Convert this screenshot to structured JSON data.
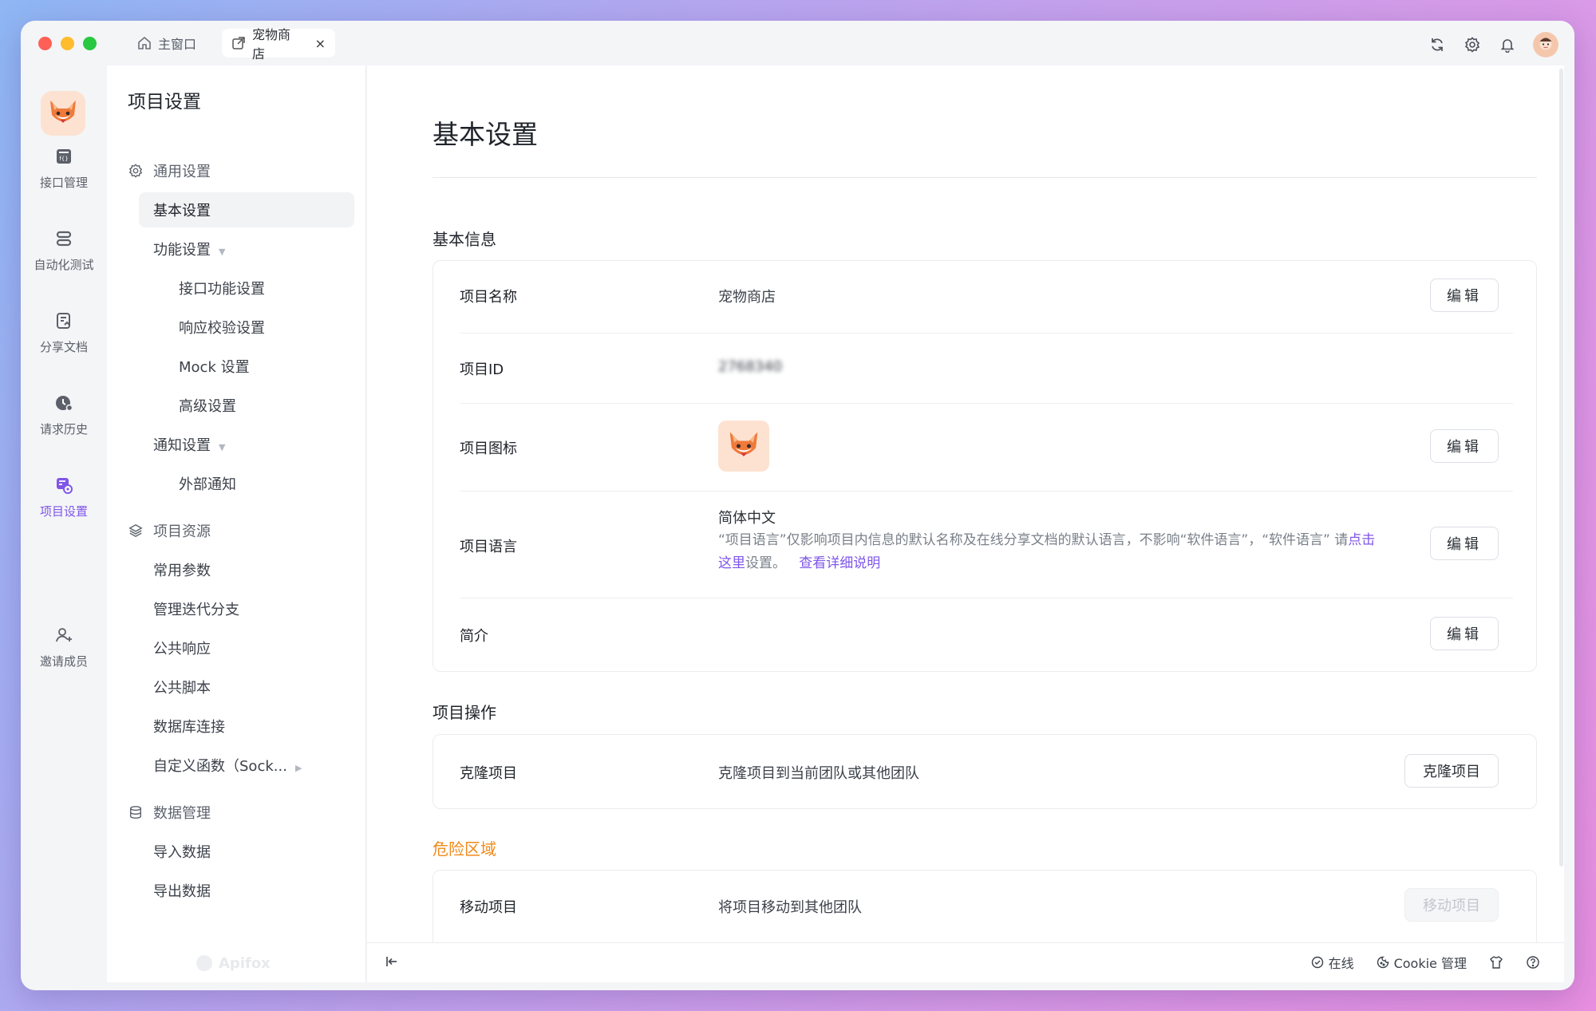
{
  "tabs": [
    {
      "label": "主窗口",
      "icon": "home-icon"
    },
    {
      "label": "宠物商店",
      "icon": "external-link-icon",
      "close": "×"
    }
  ],
  "rail": [
    {
      "label": "接口管理",
      "icon": "api-management-icon"
    },
    {
      "label": "自动化测试",
      "icon": "automation-test-icon"
    },
    {
      "label": "分享文档",
      "icon": "share-doc-icon"
    },
    {
      "label": "请求历史",
      "icon": "history-icon"
    },
    {
      "label": "项目设置",
      "icon": "project-settings-icon",
      "active": true
    },
    {
      "label": "邀请成员",
      "icon": "invite-member-icon"
    }
  ],
  "sidebar": {
    "title": "项目设置",
    "general_group": "通用设置",
    "basic": "基本设置",
    "feature": "功能设置",
    "api_feature": "接口功能设置",
    "response_check": "响应校验设置",
    "mock": "Mock 设置",
    "advanced": "高级设置",
    "notify": "通知设置",
    "external_notify": "外部通知",
    "resources_group": "项目资源",
    "common_params": "常用参数",
    "branches": "管理迭代分支",
    "public_response": "公共响应",
    "public_scripts": "公共脚本",
    "db_conn": "数据库连接",
    "custom_func": "自定义函数（Sock...",
    "data_group": "数据管理",
    "import": "导入数据",
    "export": "导出数据",
    "brand": "Apifox"
  },
  "main": {
    "title": "基本设置",
    "basic_info_title": "基本信息",
    "rows": {
      "name_label": "项目名称",
      "name_value": "宠物商店",
      "id_label": "项目ID",
      "id_value": "2768340",
      "icon_label": "项目图标",
      "lang_label": "项目语言",
      "lang_value": "简体中文",
      "lang_desc_1": "“项目语言”仅影响项目内信息的默认名称及在线分享文档的默认语言，不影响“软件语言”，“软件语言” 请",
      "lang_link": "点击这里",
      "lang_desc_2": "设置。",
      "lang_more": "查看详细说明",
      "intro_label": "简介"
    },
    "edit_label": "编辑",
    "ops_title": "项目操作",
    "clone_label": "克隆项目",
    "clone_desc": "克隆项目到当前团队或其他团队",
    "clone_btn": "克隆项目",
    "danger_title": "危险区域",
    "move_label": "移动项目",
    "move_desc": "将项目移动到其他团队",
    "move_btn": "移动项目"
  },
  "footer": {
    "online": "在线",
    "cookie": "Cookie 管理"
  },
  "colors": {
    "accent": "#7f56e8",
    "danger": "#f0891a"
  }
}
